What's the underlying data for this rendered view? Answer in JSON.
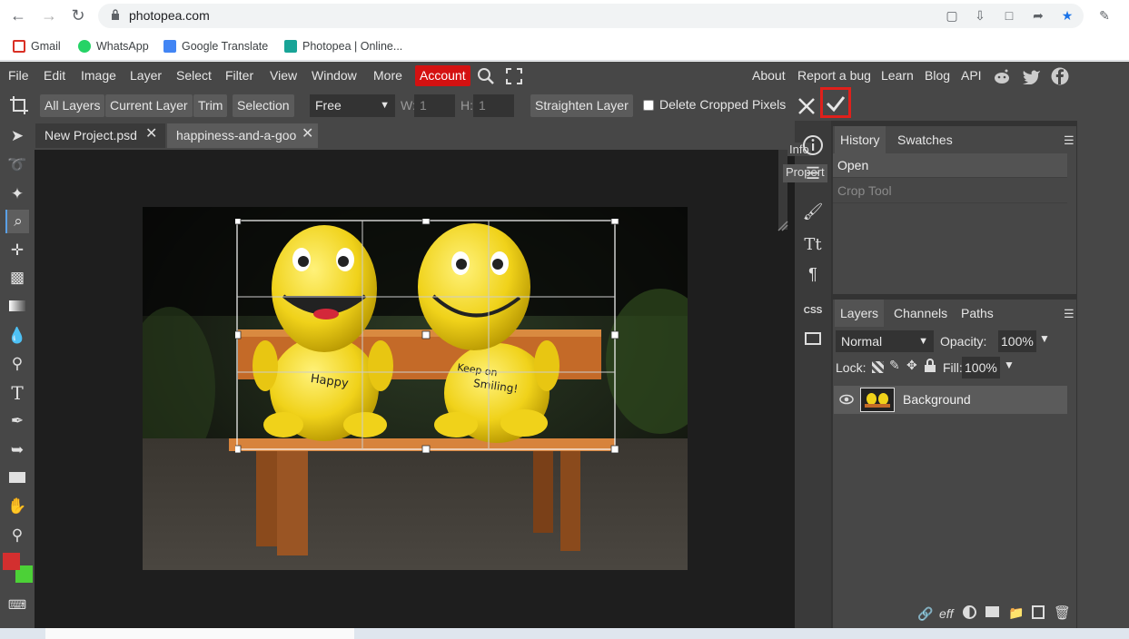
{
  "browser": {
    "url": "photopea.com",
    "bookmarks": [
      {
        "label": "Gmail",
        "color": "#d93025"
      },
      {
        "label": "WhatsApp",
        "color": "#25d366"
      },
      {
        "label": "Google Translate",
        "color": "#4285f4"
      },
      {
        "label": "Photopea | Online...",
        "color": "#18a497"
      }
    ]
  },
  "menubar": {
    "items": [
      "File",
      "Edit",
      "Image",
      "Layer",
      "Select",
      "Filter",
      "View",
      "Window",
      "More"
    ],
    "account": "Account",
    "right_items": [
      "About",
      "Report a bug",
      "Learn",
      "Blog",
      "API"
    ]
  },
  "tool_options": {
    "buttons": [
      "All Layers",
      "Current Layer",
      "Trim",
      "Selection"
    ],
    "ratio_select": "Free",
    "w_label": "W:",
    "w_value": "1",
    "h_label": "H:",
    "h_value": "1",
    "straighten": "Straighten Layer",
    "delete_cropped": "Delete Cropped Pixels"
  },
  "tabs": [
    {
      "label": "New Project.psd"
    },
    {
      "label": "happiness-and-a-goo"
    }
  ],
  "side_labels": {
    "info": "Info",
    "properties": "Propert"
  },
  "history_panel": {
    "tabs": [
      "History",
      "Swatches"
    ],
    "items": [
      "Open",
      "Crop Tool"
    ]
  },
  "layers_panel": {
    "tabs": [
      "Layers",
      "Channels",
      "Paths"
    ],
    "blend_mode": "Normal",
    "opacity_label": "Opacity:",
    "opacity_value": "100%",
    "lock_label": "Lock:",
    "fill_label": "Fill:",
    "fill_value": "100%",
    "layers": [
      {
        "name": "Background"
      }
    ]
  },
  "colors": {
    "foreground": "#d32f2f",
    "background": "#4cd137",
    "accent_red": "#d41111",
    "commit_highlight": "#e0201b"
  },
  "icons": {
    "css": "CSS"
  }
}
